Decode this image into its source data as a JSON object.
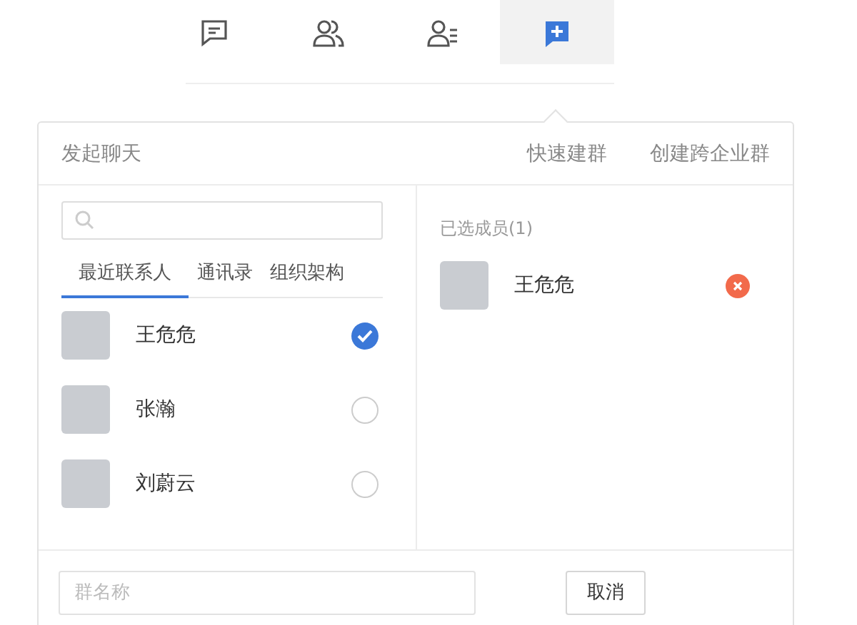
{
  "nav_tabs": [
    {
      "kind": "chat",
      "selected": false
    },
    {
      "kind": "contacts",
      "selected": false
    },
    {
      "kind": "directory",
      "selected": false
    },
    {
      "kind": "new",
      "selected": true
    }
  ],
  "dialog": {
    "title": "发起聊天",
    "actions": [
      "快速建群",
      "创建跨企业群"
    ]
  },
  "contact_tabs": [
    {
      "label": "最近联系人",
      "selected": true
    },
    {
      "label": "通讯录",
      "selected": false
    },
    {
      "label": "组织架构",
      "selected": false
    }
  ],
  "contacts": [
    {
      "name": "王危危",
      "checked": true
    },
    {
      "name": "张瀚",
      "checked": false
    },
    {
      "name": "刘蔚云",
      "checked": false
    }
  ],
  "selected_members": {
    "label": "已选成员(1)",
    "members": [
      {
        "name": "王危危"
      }
    ]
  },
  "group_name": {
    "placeholder": "群名称"
  },
  "buttons": [
    "取消"
  ]
}
